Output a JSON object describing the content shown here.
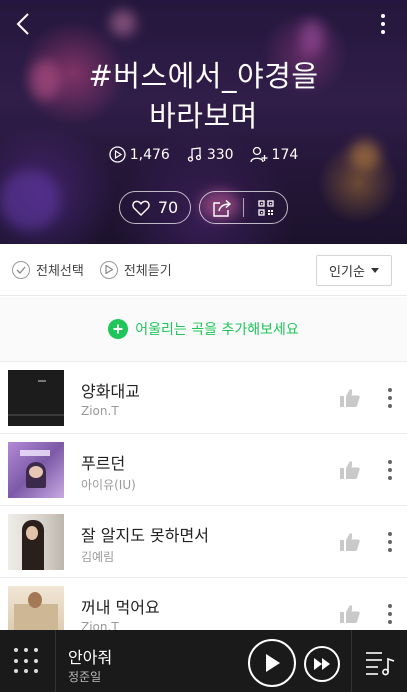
{
  "header": {
    "title_line1": "#버스에서_야경을",
    "title_line2": "바라보며",
    "back_icon": "chevron-left-icon",
    "more_icon": "more-vertical-icon"
  },
  "stats": {
    "plays": "1,476",
    "songs": "330",
    "followers": "174"
  },
  "actions": {
    "likes": "70"
  },
  "toolbar": {
    "select_all": "전체선택",
    "play_all": "전체듣기",
    "sort_label": "인기순"
  },
  "add_banner": {
    "label": "어울리는 곡을 추가해보세요"
  },
  "songs": [
    {
      "title": "양화대교",
      "artist": "Zion.T"
    },
    {
      "title": "푸르던",
      "artist": "아이유(IU)"
    },
    {
      "title": "잘 알지도 못하면서",
      "artist": "김예림"
    },
    {
      "title": "꺼내 먹어요",
      "artist": "Zion.T"
    }
  ],
  "player": {
    "title": "안아줘",
    "artist": "정준일"
  },
  "colors": {
    "accent": "#1ec65a",
    "player_bg": "#1a1a1a"
  }
}
